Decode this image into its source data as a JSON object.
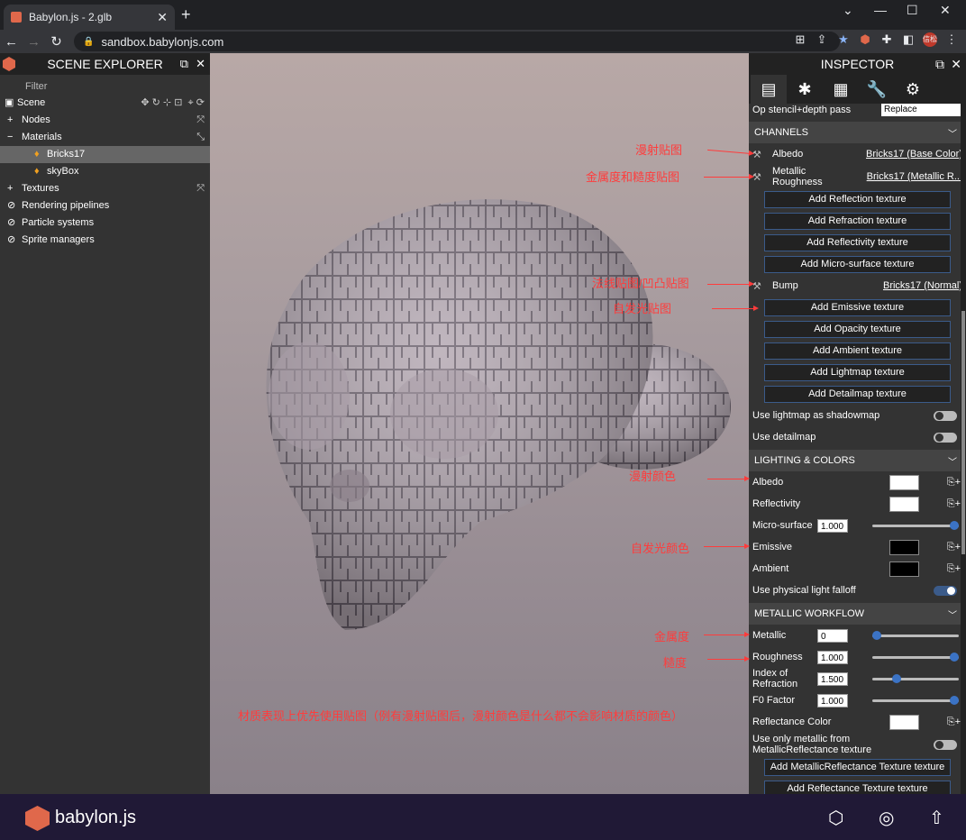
{
  "browser": {
    "tab_title": "Babylon.js - 2.glb",
    "url": "sandbox.babylonjs.com",
    "avatar_text": "信松"
  },
  "scene_explorer": {
    "title": "SCENE EXPLORER",
    "filter": "Filter",
    "items": [
      {
        "label": "Scene"
      },
      {
        "label": "Nodes"
      },
      {
        "label": "Materials"
      },
      {
        "label": "Bricks17"
      },
      {
        "label": "skyBox"
      },
      {
        "label": "Textures"
      },
      {
        "label": "Rendering pipelines"
      },
      {
        "label": "Particle systems"
      },
      {
        "label": "Sprite managers"
      }
    ]
  },
  "inspector": {
    "title": "INSPECTOR",
    "stencil_label": "Op stencil+depth pass",
    "stencil_value": "Replace",
    "channels": {
      "title": "CHANNELS",
      "albedo": "Albedo",
      "albedo_tex": "Bricks17 (Base Color)",
      "metal_rough": "Metallic Roughness",
      "metal_rough_tex": "Bricks17 (Metallic R...",
      "bump": "Bump",
      "bump_tex": "Bricks17 (Normal)",
      "add_reflection": "Add Reflection texture",
      "add_refraction": "Add Refraction texture",
      "add_reflectivity": "Add Reflectivity texture",
      "add_micro": "Add Micro-surface texture",
      "add_emissive": "Add Emissive texture",
      "add_opacity": "Add Opacity texture",
      "add_ambient": "Add Ambient texture",
      "add_lightmap": "Add Lightmap texture",
      "add_detailmap": "Add Detailmap texture",
      "use_lightmap": "Use lightmap as shadowmap",
      "use_detailmap": "Use detailmap"
    },
    "lighting": {
      "title": "LIGHTING & COLORS",
      "albedo": "Albedo",
      "reflectivity": "Reflectivity",
      "micro": "Micro-surface",
      "micro_val": "1.000",
      "emissive": "Emissive",
      "ambient": "Ambient",
      "physical": "Use physical light falloff"
    },
    "metallic": {
      "title": "METALLIC WORKFLOW",
      "metallic": "Metallic",
      "metallic_val": "0",
      "roughness": "Roughness",
      "roughness_val": "1.000",
      "ior": "Index of Refraction",
      "ior_val": "1.500",
      "f0": "F0 Factor",
      "f0_val": "1.000",
      "refl_color": "Reflectance Color",
      "only_metallic": "Use only metallic from MetallicReflectance texture",
      "add_metal_refl": "Add MetallicReflectance Texture texture",
      "add_refl_tex": "Add Reflectance Texture texture"
    }
  },
  "annotations": {
    "diffuse_map": "漫射贴图",
    "metal_rough_map": "金属度和糙度贴图",
    "normal_map": "法线贴图/凹凸贴图",
    "emissive_map": "自发光贴图",
    "diffuse_color": "漫射颜色",
    "emissive_color": "自发光颜色",
    "metallic": "金属度",
    "roughness": "糙度",
    "note": "材质表现上优先使用贴图（例有漫射贴图后，漫射颜色是什么都不会影响材质的颜色）"
  },
  "bottom": {
    "brand": "babylon.js"
  }
}
